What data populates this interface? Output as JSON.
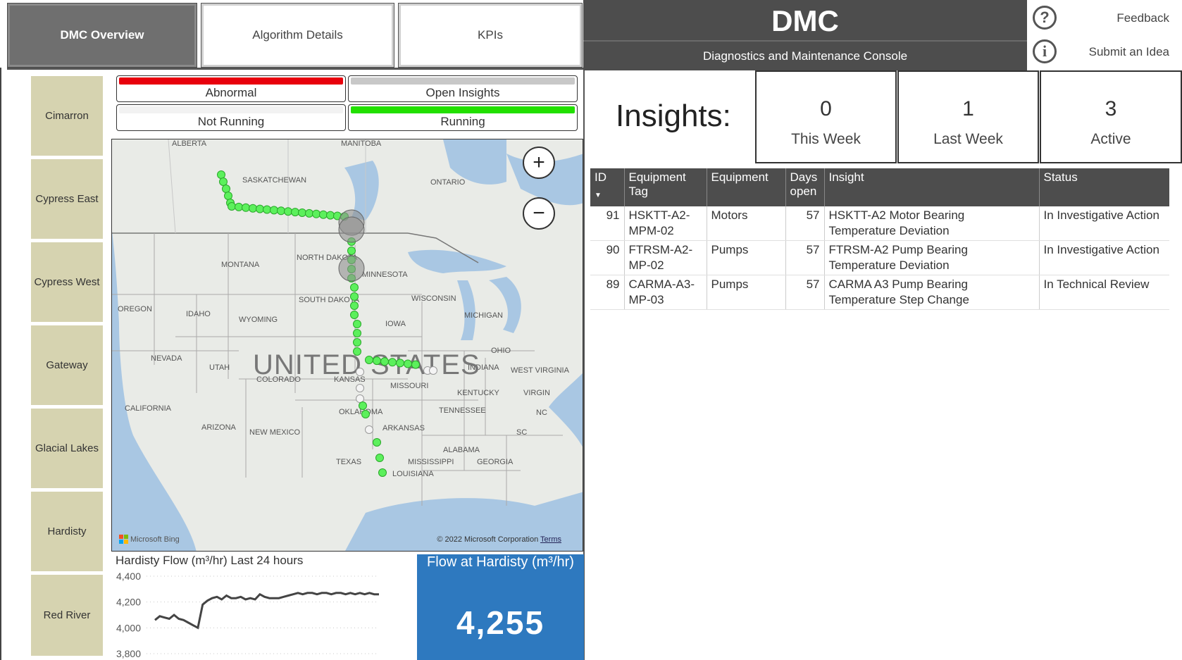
{
  "tabs": [
    {
      "label": "DMC Overview",
      "active": true
    },
    {
      "label": "Algorithm Details",
      "active": false
    },
    {
      "label": "KPIs",
      "active": false
    }
  ],
  "header": {
    "title": "DMC",
    "subtitle": "Diagnostics and Maintenance Console"
  },
  "links": {
    "feedback": "Feedback",
    "submit_idea": "Submit an Idea"
  },
  "sidebar": {
    "items": [
      {
        "label": "Cimarron"
      },
      {
        "label": "Cypress East"
      },
      {
        "label": "Cypress West"
      },
      {
        "label": "Gateway"
      },
      {
        "label": "Glacial Lakes"
      },
      {
        "label": "Hardisty"
      },
      {
        "label": "Red River"
      }
    ]
  },
  "status": {
    "abnormal": {
      "label": "Abnormal",
      "color": "#e8000d"
    },
    "open_insights": {
      "label": "Open Insights",
      "color": "#c8c8c8"
    },
    "not_running": {
      "label": "Not Running",
      "color": "#f2f2f2"
    },
    "running": {
      "label": "Running",
      "color": "#22e000"
    }
  },
  "map": {
    "country_label": "UNITED STATES",
    "regions": [
      "ALBERTA",
      "MANITOBA",
      "SASKATCHEWAN",
      "ONTARIO",
      "MONTANA",
      "NORTH DAKOTA",
      "MINNESOTA",
      "SOUTH DAKOTA",
      "WISCONSIN",
      "MICHIGAN",
      "OREGON",
      "IDAHO",
      "WYOMING",
      "IOWA",
      "NEVADA",
      "UTAH",
      "COLORADO",
      "KANSAS",
      "MISSOURI",
      "INDIANA",
      "OHIO",
      "WEST VIRGINIA",
      "KENTUCKY",
      "VIRGIN",
      "CALIFORNIA",
      "ARIZONA",
      "NEW MEXICO",
      "OKLAHOMA",
      "ARKANSAS",
      "TENNESSEE",
      "NC",
      "SC",
      "ALABAMA",
      "MISSISSIPPI",
      "GEORGIA",
      "TEXAS",
      "LOUISIANA"
    ],
    "bing_label": "Microsoft Bing",
    "copyright": "© 2022 Microsoft Corporation",
    "terms": "Terms",
    "zoom_in": "+",
    "zoom_out": "−"
  },
  "insights": {
    "heading": "Insights:",
    "kpis": [
      {
        "value": "0",
        "label": "This Week"
      },
      {
        "value": "1",
        "label": "Last Week"
      },
      {
        "value": "3",
        "label": "Active"
      }
    ],
    "columns": [
      "ID",
      "Equipment Tag",
      "Equipment",
      "Days open",
      "Insight",
      "Status"
    ],
    "rows": [
      {
        "id": "91",
        "tag": "HSKTT-A2-MPM-02",
        "equipment": "Motors",
        "days": "57",
        "insight": "HSKTT-A2 Motor Bearing Temperature Deviation",
        "status": "In Investigative Action"
      },
      {
        "id": "90",
        "tag": "FTRSM-A2-MP-02",
        "equipment": "Pumps",
        "days": "57",
        "insight": "FTRSM-A2 Pump Bearing Temperature Deviation",
        "status": "In Investigative Action"
      },
      {
        "id": "89",
        "tag": "CARMA-A3-MP-03",
        "equipment": "Pumps",
        "days": "57",
        "insight": "CARMA A3 Pump Bearing Temperature Step Change",
        "status": "In Technical Review"
      }
    ]
  },
  "flow_chart_title": "Hardisty Flow (m³/hr) Last 24 hours",
  "chart_data": {
    "type": "line",
    "title": "Hardisty Flow (m³/hr) Last 24 hours",
    "ylim": [
      3800,
      4400
    ],
    "yticks": [
      "4,400",
      "4,200",
      "4,000",
      "3,800"
    ],
    "series": [
      {
        "values": [
          4060,
          4090,
          4080,
          4070,
          4100,
          4070,
          4060,
          4040,
          4020,
          4000,
          4180,
          4210,
          4230,
          4240,
          4220,
          4250,
          4230,
          4230,
          4240,
          4220,
          4230,
          4220,
          4260,
          4240,
          4230,
          4230,
          4230,
          4240,
          4250,
          4260,
          4270,
          4260,
          4270,
          4270,
          4260,
          4270,
          4270,
          4260,
          4270,
          4270,
          4260,
          4270,
          4260,
          4270,
          4260,
          4270,
          4260,
          4260
        ]
      }
    ]
  },
  "flow_card": {
    "title": "Flow at Hardisty (m³/hr)",
    "value": "4,255"
  },
  "colors": {
    "header_bg": "#4d4d4d",
    "sidebar_bg": "#d6d3b0",
    "flow_card": "#2e79bf",
    "pipeline_green": "#5cf05c"
  }
}
